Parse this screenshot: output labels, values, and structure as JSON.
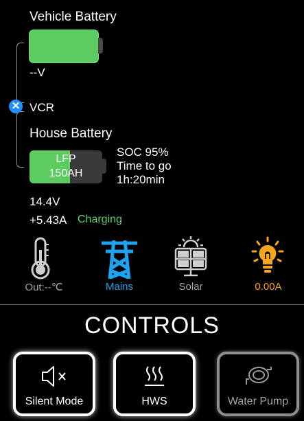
{
  "vehicle_battery": {
    "title": "Vehicle Battery",
    "voltage": "--V"
  },
  "vcr": {
    "label": "VCR"
  },
  "house_battery": {
    "title": "House Battery",
    "type_label": "LFP",
    "capacity_label": "150AH",
    "soc_fraction": 0.56,
    "soc_text": "SOC 95%",
    "time_to_go_label": "Time to go",
    "time_to_go_value": "1h:20min",
    "voltage": "14.4V",
    "current": "+5.43A",
    "status": "Charging"
  },
  "status_icons": [
    {
      "icon": "thermometer-icon",
      "label": "Out:--℃"
    },
    {
      "icon": "power-pylon-icon",
      "label": "Mains"
    },
    {
      "icon": "solar-panel-icon",
      "label": "Solar"
    },
    {
      "icon": "lightbulb-icon",
      "label": "0.00A"
    }
  ],
  "controls": {
    "title": "CONTROLS",
    "buttons": [
      {
        "icon": "speaker-mute-icon",
        "label": "Silent Mode",
        "enabled": true
      },
      {
        "icon": "heat-waves-icon",
        "label": "HWS",
        "enabled": true
      },
      {
        "icon": "water-pump-icon",
        "label": "Water Pump",
        "enabled": false
      }
    ]
  },
  "colors": {
    "battery_green": "#5ccc62",
    "charging_green": "#5fcf66",
    "mains_blue": "#1ea3f0",
    "load_orange": "#f7a51c",
    "inactive_grey": "#a3a3a3"
  }
}
